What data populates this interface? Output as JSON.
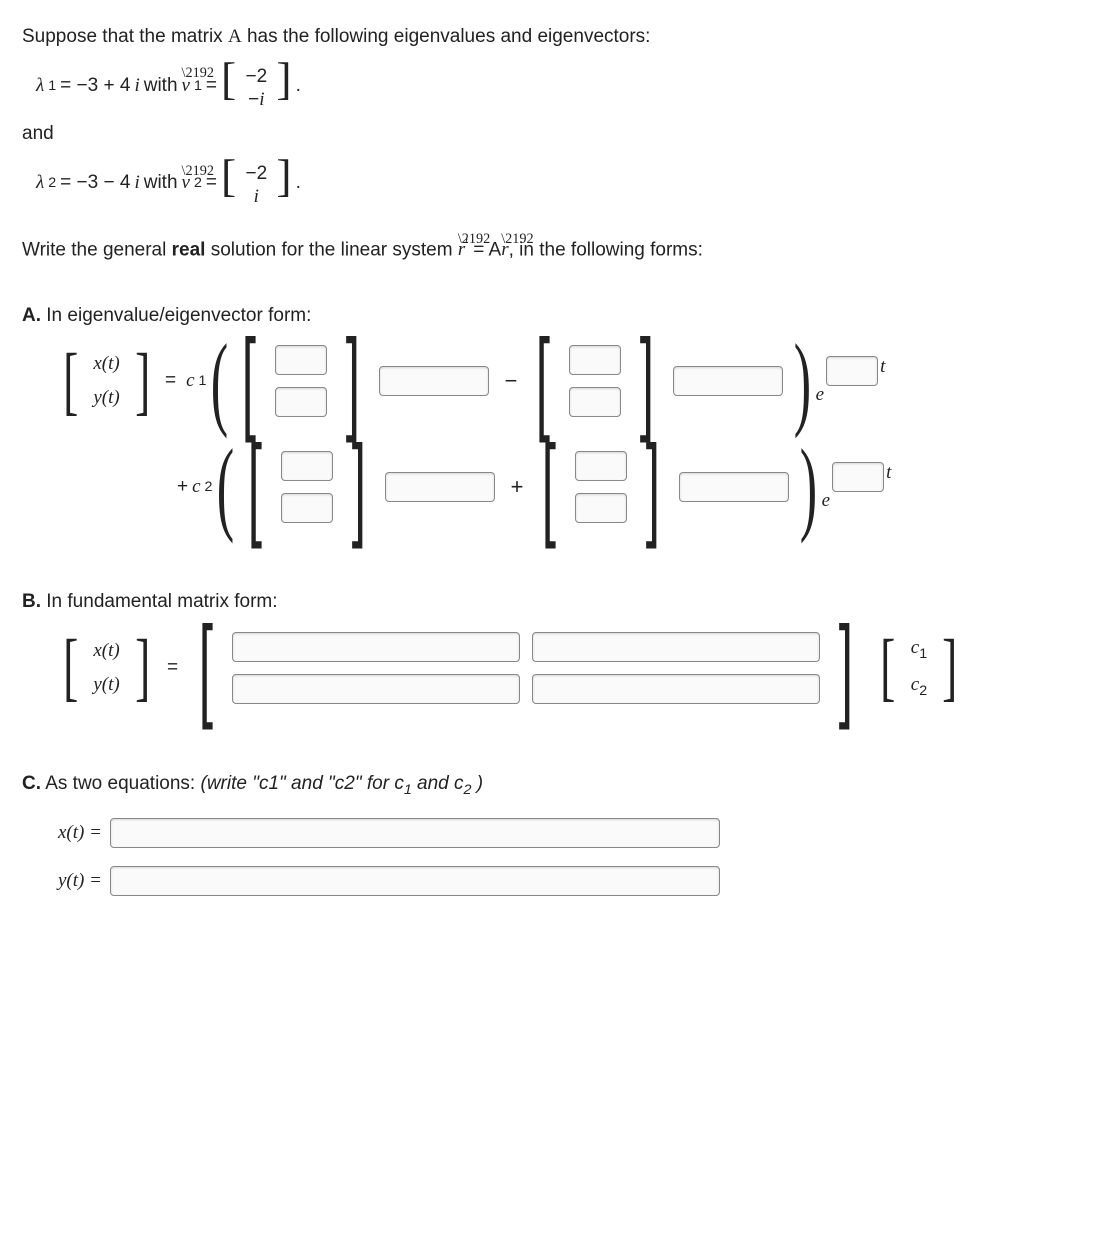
{
  "intro": {
    "l1a": "Suppose that the matrix ",
    "matA": "A",
    "l1b": " has the following eigenvalues and eigenvectors:",
    "lam1_lhs": "λ",
    "lam1_sub": "1",
    "lam1_val": " = −3 + 4",
    "i": "i",
    "with": " with ",
    "v": "v",
    "eq": " = ",
    "vec1_top": "−2",
    "vec1_bot": "−i",
    "and": "and",
    "lam2_sub": "2",
    "lam2_val": " = −3 − 4",
    "vec2_top": "−2",
    "vec2_bot": "i",
    "dot": "."
  },
  "prompt": {
    "a": "Write the general ",
    "real": "real",
    "b": " solution for the linear system ",
    "r": "r",
    "prime": "′",
    "eqs": " = A",
    "c": ", in the following forms:"
  },
  "A": {
    "heading_b": "A.",
    "heading": " In eigenvalue/eigenvector form:",
    "xt": "x(t)",
    "yt": "y(t)",
    "c1": "c",
    "c1s": "1",
    "c2s": "2",
    "minus": "−",
    "plus": "+",
    "e": "e",
    "t": "t",
    "plus_c2": " + c"
  },
  "B": {
    "heading_b": "B.",
    "heading": " In fundamental matrix form:",
    "c1": "c",
    "c1s": "1",
    "c2s": "2"
  },
  "C": {
    "heading_b": "C.",
    "heading": " As two equations: ",
    "hint": "(write \"c1\" and \"c2\" for c",
    "hint_s1": "1",
    "hint_mid": " and c",
    "hint_s2": "2",
    "hint_end": " )",
    "xlbl": "x(t) = ",
    "ylbl": "y(t) = "
  }
}
